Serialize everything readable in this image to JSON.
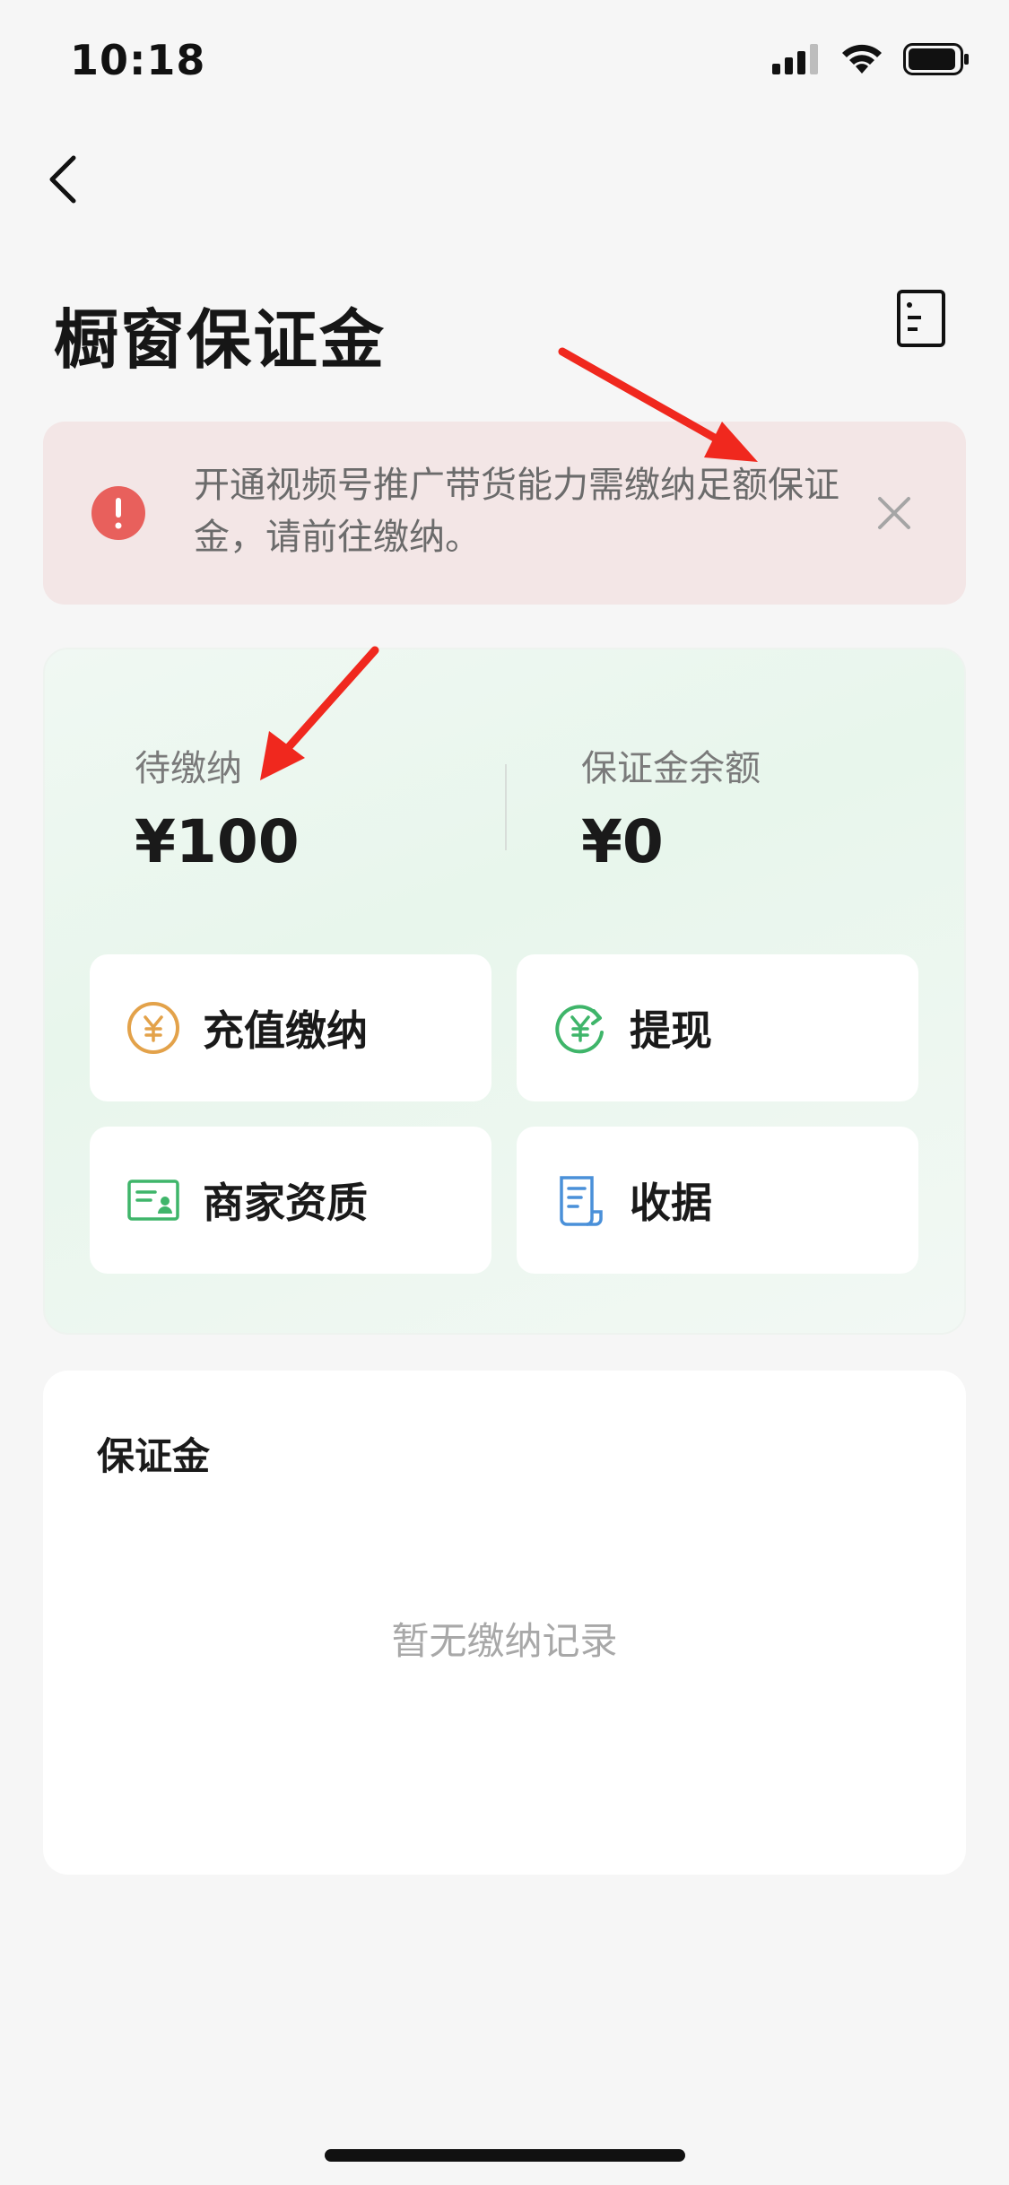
{
  "status_bar": {
    "time": "10:18"
  },
  "header": {
    "title": "橱窗保证金"
  },
  "alert": {
    "message": "开通视频号推广带货能力需缴纳足额保证金，请前往缴纳。"
  },
  "balances": {
    "pending": {
      "label": "待缴纳",
      "value": "¥100"
    },
    "balance": {
      "label": "保证金余额",
      "value": "¥0"
    }
  },
  "actions": [
    {
      "label": "充值缴纳",
      "icon": "yuan-coin-icon"
    },
    {
      "label": "提现",
      "icon": "withdraw-icon"
    },
    {
      "label": "商家资质",
      "icon": "merchant-certificate-icon"
    },
    {
      "label": "收据",
      "icon": "receipt-icon"
    }
  ],
  "records": {
    "title": "保证金",
    "empty_text": "暂无缴纳记录"
  },
  "colors": {
    "alert_bg": "#f3e6e6",
    "alert_icon": "#e8605c",
    "annotation_arrow": "#f0281e",
    "accent_orange": "#e3a24a",
    "accent_green": "#3fb56a",
    "accent_blue": "#4a90d9"
  }
}
